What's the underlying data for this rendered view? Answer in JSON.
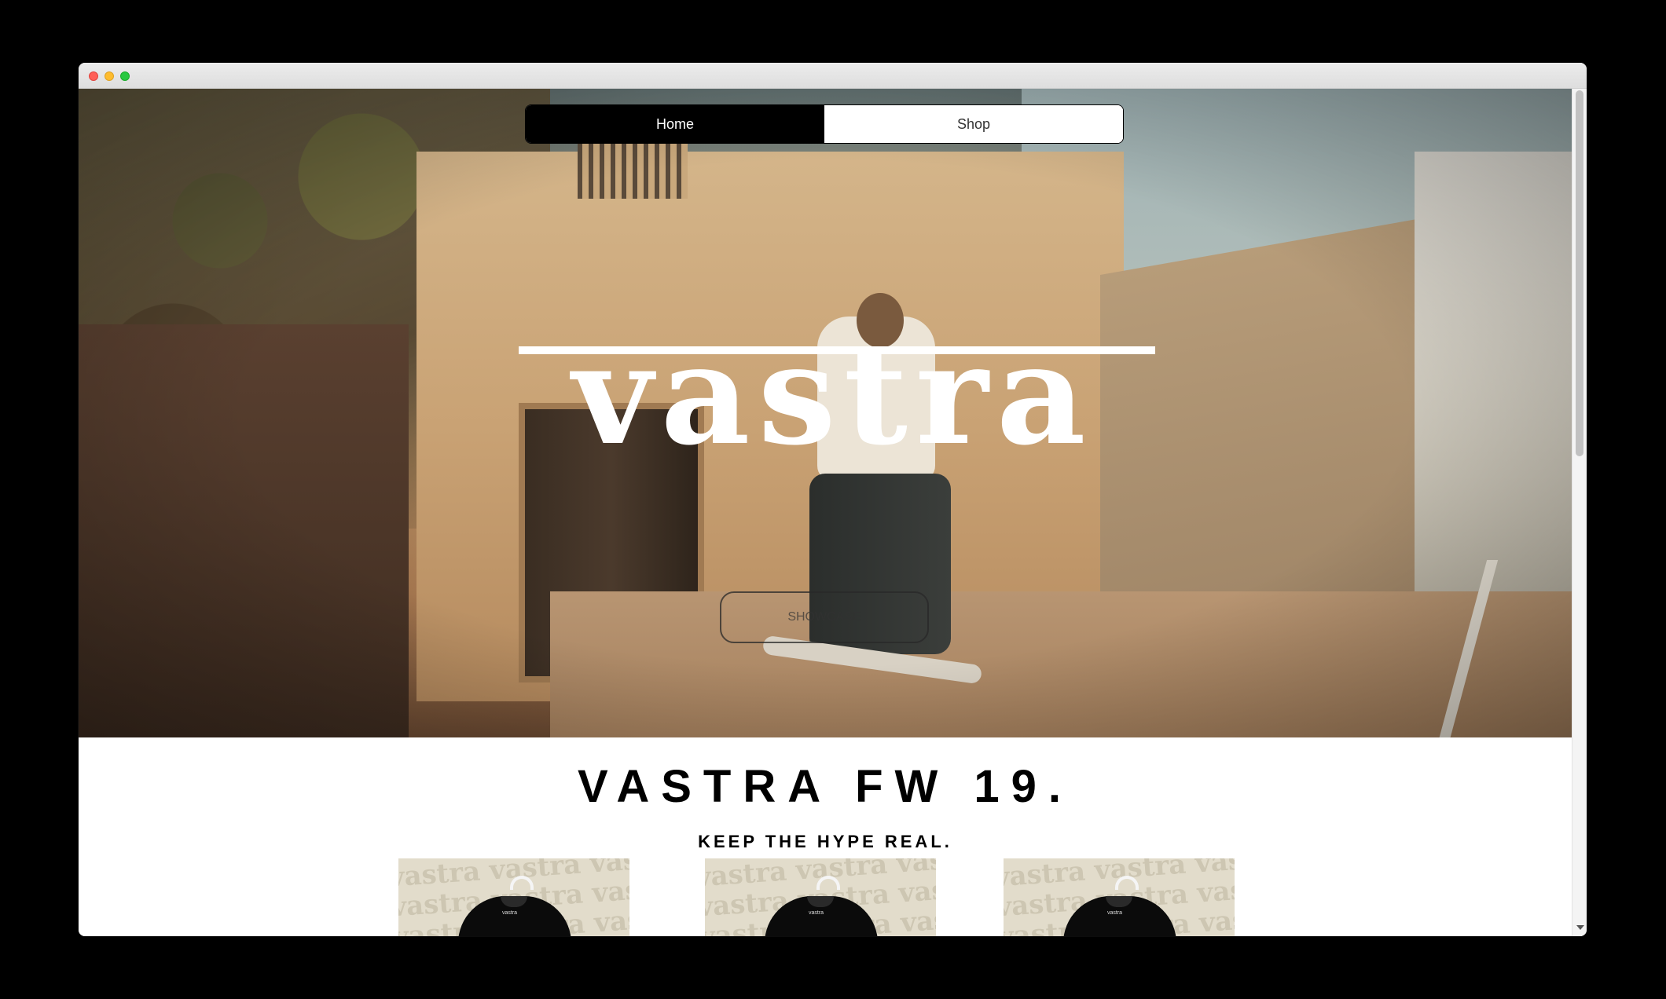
{
  "window": {
    "controls": [
      "close",
      "minimize",
      "maximize"
    ]
  },
  "nav": {
    "items": [
      {
        "label": "Home",
        "active": true
      },
      {
        "label": "Shop",
        "active": false
      }
    ]
  },
  "hero": {
    "logo": "vastra",
    "button_label": "SHOWCASE"
  },
  "collection": {
    "title": "VASTRA FW 19.",
    "tagline": "KEEP THE HYPE REAL."
  },
  "products": [
    {
      "pattern_text": "vastra vastra vastra",
      "tag": "vastra"
    },
    {
      "pattern_text": "vastra vastra vastra",
      "tag": "vastra"
    },
    {
      "pattern_text": "vastra vastra vastra",
      "tag": "vastra"
    }
  ],
  "colors": {
    "nav_active_bg": "#000000",
    "nav_inactive_bg": "#ffffff",
    "product_bg": "#e2dccb"
  }
}
